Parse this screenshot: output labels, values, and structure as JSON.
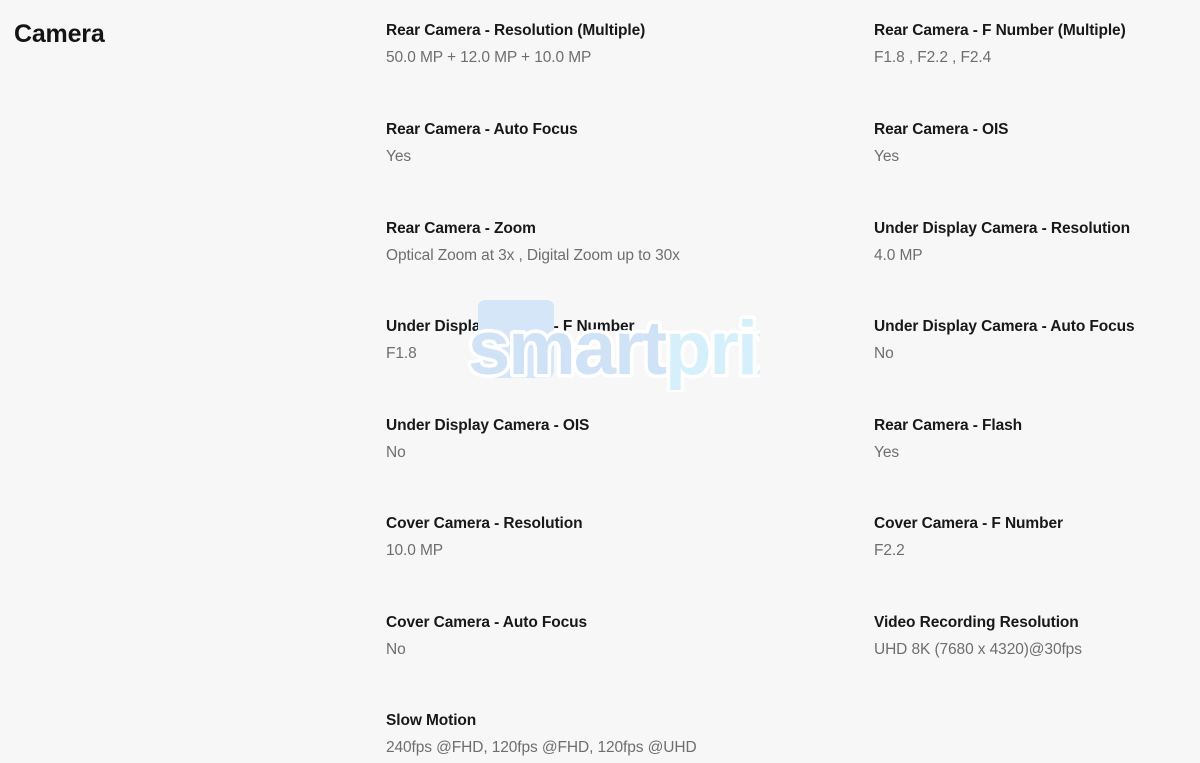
{
  "section": {
    "title": "Camera"
  },
  "watermark": {
    "text": "smartprix",
    "part_one": "smart",
    "part_two": "prix",
    "color_primary": "#cfe2f6",
    "color_secondary": "#d6f0fb",
    "block_color": "#d5e6f8",
    "outline_color": "#ffffff"
  },
  "colors": {
    "background": "#f7f7f7",
    "label": "#16181a",
    "value": "#6e6e6e",
    "title": "#141414"
  },
  "specs": {
    "left_column": [
      {
        "label": "Rear Camera - Resolution (Multiple)",
        "value": "50.0 MP + 12.0 MP + 10.0 MP"
      },
      {
        "label": "Rear Camera - Auto Focus",
        "value": "Yes"
      },
      {
        "label": "Rear Camera - Zoom",
        "value": "Optical Zoom at 3x , Digital Zoom up to 30x"
      },
      {
        "label": "Under Display Camera - F Number",
        "value": "F1.8"
      },
      {
        "label": "Under Display Camera - OIS",
        "value": "No"
      },
      {
        "label": "Cover Camera - Resolution",
        "value": "10.0 MP"
      },
      {
        "label": "Cover Camera - Auto Focus",
        "value": "No"
      },
      {
        "label": "Slow Motion",
        "value": "240fps @FHD, 120fps @FHD, 120fps @UHD"
      }
    ],
    "right_column": [
      {
        "label": "Rear Camera - F Number (Multiple)",
        "value": "F1.8 , F2.2 , F2.4"
      },
      {
        "label": "Rear Camera - OIS",
        "value": "Yes"
      },
      {
        "label": "Under Display Camera - Resolution",
        "value": "4.0 MP"
      },
      {
        "label": "Under Display Camera - Auto Focus",
        "value": "No"
      },
      {
        "label": "Rear Camera - Flash",
        "value": "Yes"
      },
      {
        "label": "Cover Camera - F Number",
        "value": "F2.2"
      },
      {
        "label": "Video Recording Resolution",
        "value": "UHD 8K (7680 x 4320)@30fps"
      },
      {
        "label": "",
        "value": ""
      }
    ]
  }
}
